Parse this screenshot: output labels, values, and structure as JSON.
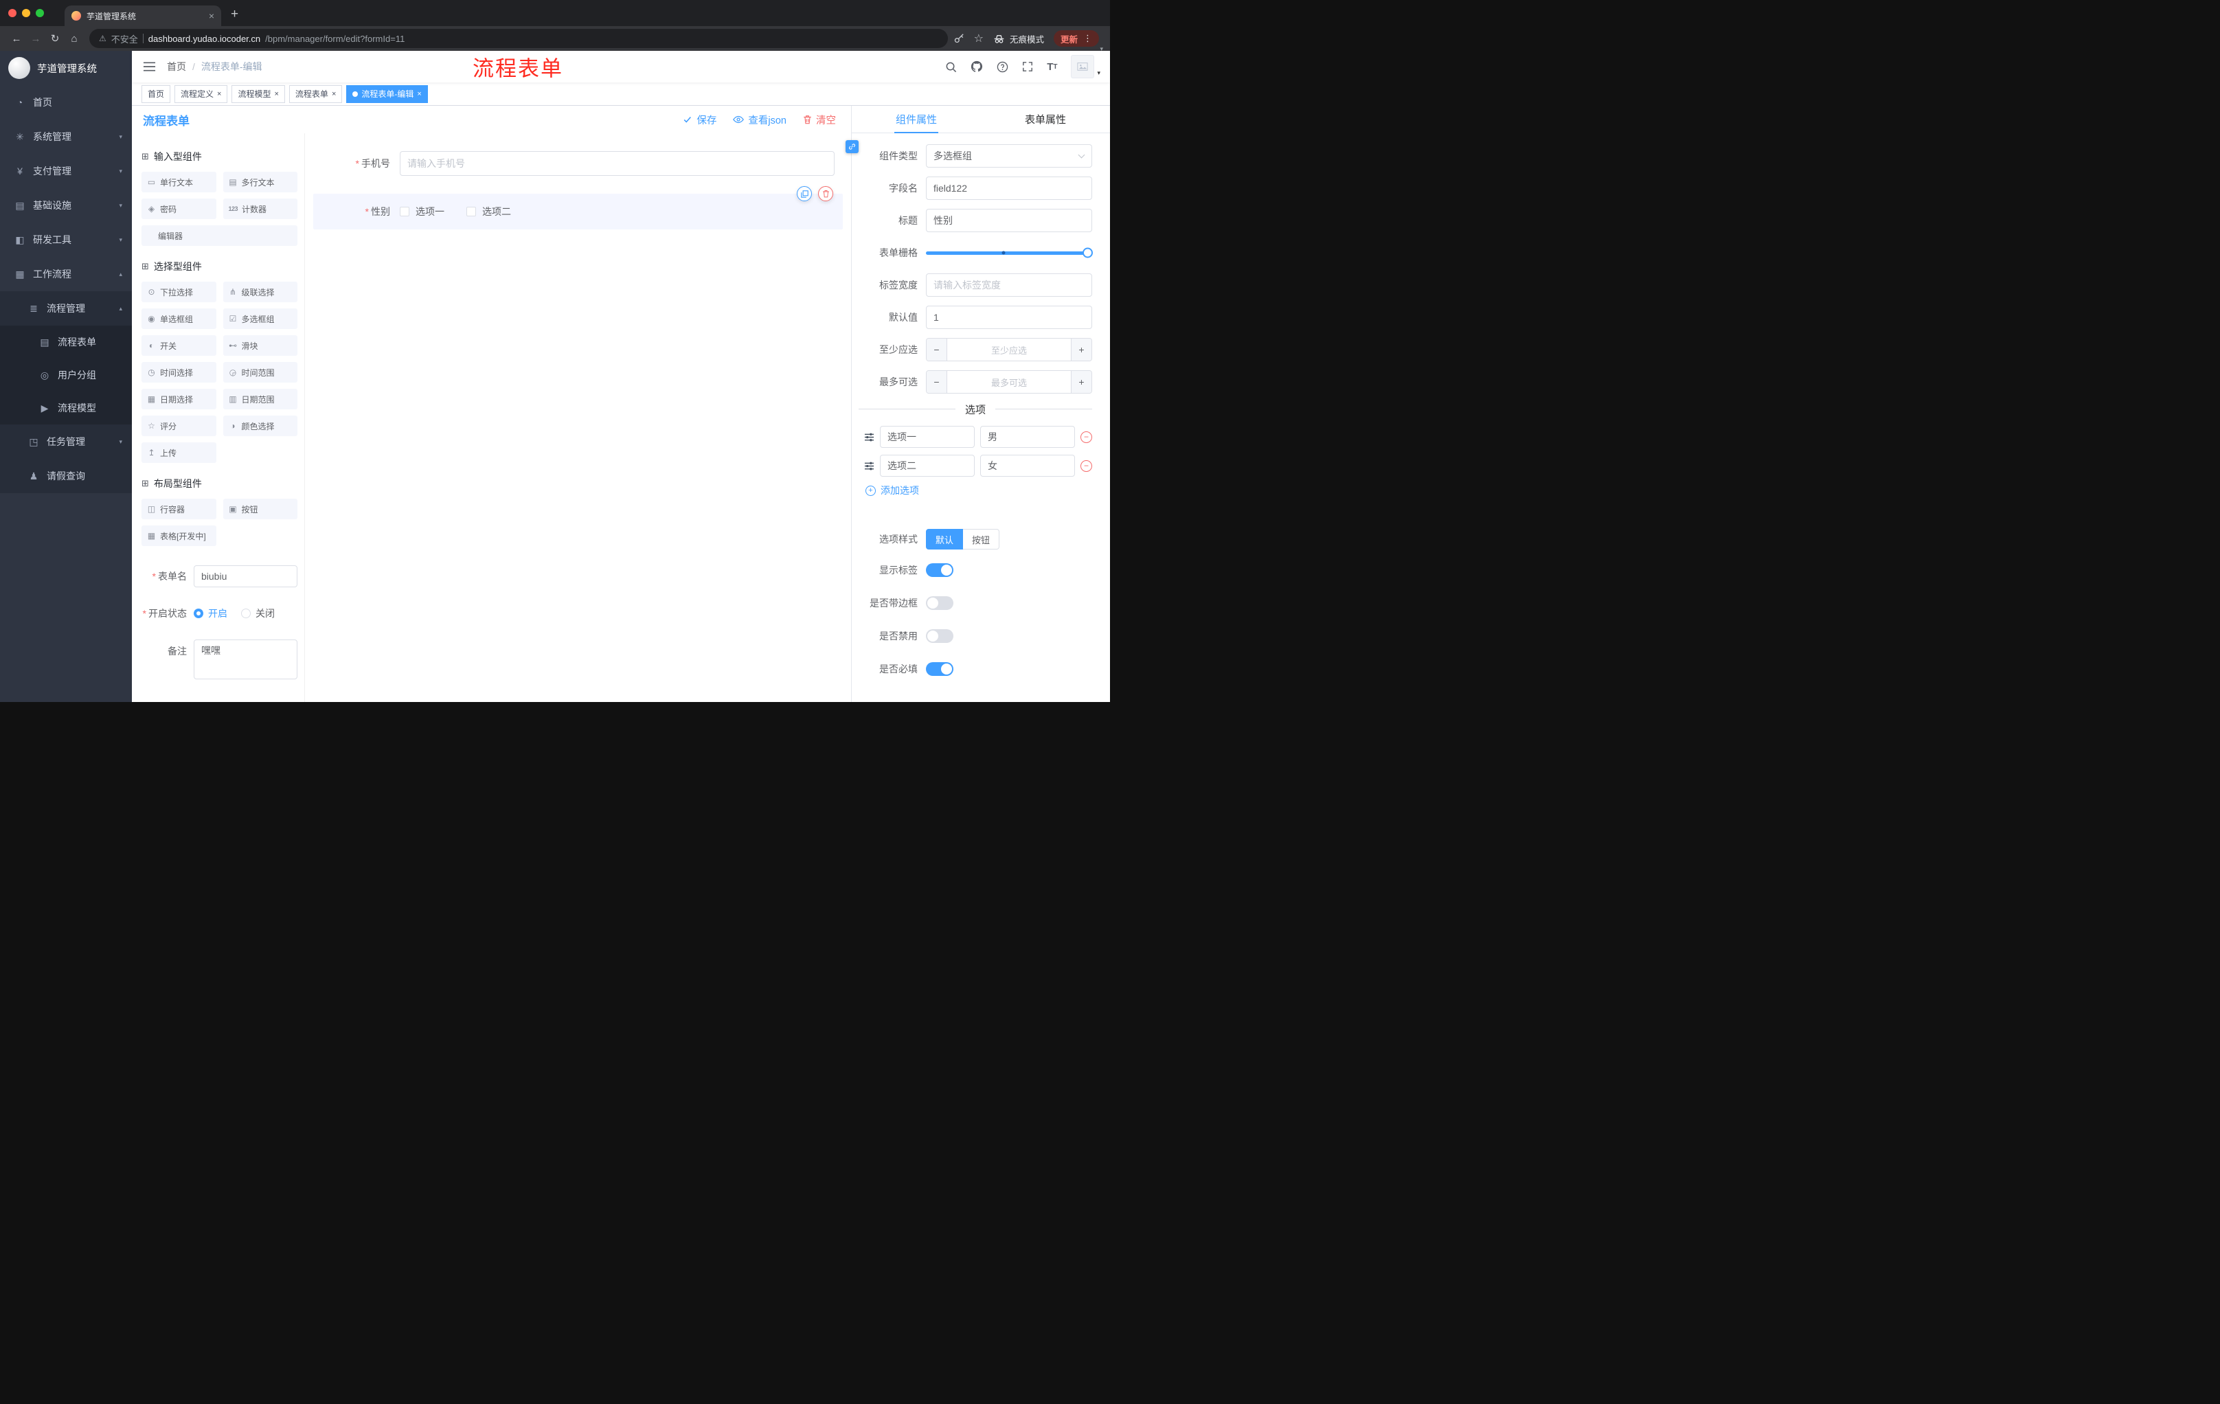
{
  "browser": {
    "tab_title": "芋道管理系统",
    "security_label": "不安全",
    "url_domain": "dashboard.yudao.iocoder.cn",
    "url_path": "/bpm/manager/form/edit?formId=11",
    "incognito_label": "无痕模式",
    "update_label": "更新"
  },
  "icons": {
    "close": "×",
    "plus": "+",
    "dots": "⋮",
    "warning": "⚠",
    "star": "☆",
    "back": "←",
    "forward": "→",
    "reload": "↻",
    "home": "⌂",
    "caret_down": "▾",
    "asterisk": "*",
    "minus": "−",
    "plus_small": "+",
    "group": "⊞"
  },
  "sidebar": {
    "logo_title": "芋道管理系统",
    "items": [
      {
        "label": "首页",
        "icon": "◔"
      },
      {
        "label": "系统管理",
        "icon": "✳",
        "chevron": "▾"
      },
      {
        "label": "支付管理",
        "icon": "¥",
        "chevron": "▾"
      },
      {
        "label": "基础设施",
        "icon": "▤",
        "chevron": "▾"
      },
      {
        "label": "研发工具",
        "icon": "◧",
        "chevron": "▾"
      },
      {
        "label": "工作流程",
        "icon": "▦",
        "chevron": "▴"
      },
      {
        "label": "流程管理",
        "icon": "≣",
        "chevron": "▴"
      },
      {
        "label": "流程表单",
        "icon": "▤"
      },
      {
        "label": "用户分组",
        "icon": "◎"
      },
      {
        "label": "流程模型",
        "icon": "▶"
      },
      {
        "label": "任务管理",
        "icon": "◳",
        "chevron": "▾"
      },
      {
        "label": "请假查询",
        "icon": "♟"
      }
    ]
  },
  "header": {
    "breadcrumb_home": "首页",
    "breadcrumb_sep": "/",
    "breadcrumb_current": "流程表单-编辑",
    "annotation": "流程表单"
  },
  "tags": [
    {
      "label": "首页"
    },
    {
      "label": "流程定义"
    },
    {
      "label": "流程模型"
    },
    {
      "label": "流程表单"
    },
    {
      "label": "流程表单-编辑"
    }
  ],
  "designer": {
    "title": "流程表单",
    "save_label": "保存",
    "view_json_label": "查看json",
    "clear_label": "清空",
    "palette_groups": [
      {
        "title": "输入型组件",
        "items": [
          {
            "label": "单行文本",
            "icon": "▭"
          },
          {
            "label": "多行文本",
            "icon": "▤"
          },
          {
            "label": "密码",
            "icon": "◈"
          },
          {
            "label": "计数器",
            "icon": "123"
          },
          {
            "label": "编辑器",
            "icon": ""
          }
        ]
      },
      {
        "title": "选择型组件",
        "items": [
          {
            "label": "下拉选择",
            "icon": "⊙"
          },
          {
            "label": "级联选择",
            "icon": "⋔"
          },
          {
            "label": "单选框组",
            "icon": "◉"
          },
          {
            "label": "多选框组",
            "icon": "☑"
          },
          {
            "label": "开关",
            "icon": "◐"
          },
          {
            "label": "滑块",
            "icon": "⊷"
          },
          {
            "label": "时间选择",
            "icon": "◷"
          },
          {
            "label": "时间范围",
            "icon": "◶"
          },
          {
            "label": "日期选择",
            "icon": "▦"
          },
          {
            "label": "日期范围",
            "icon": "▥"
          },
          {
            "label": "评分",
            "icon": "☆"
          },
          {
            "label": "颜色选择",
            "icon": "◑"
          },
          {
            "label": "上传",
            "icon": "↥"
          }
        ]
      },
      {
        "title": "布局型组件",
        "items": [
          {
            "label": "行容器",
            "icon": "◫"
          },
          {
            "label": "按钮",
            "icon": "▣"
          },
          {
            "label": "表格[开发中]",
            "icon": "▦"
          }
        ]
      }
    ],
    "meta": {
      "name_label": "表单名",
      "name_value": "biubiu",
      "status_label": "开启状态",
      "status_on": "开启",
      "status_off": "关闭",
      "remark_label": "备注",
      "remark_value": "嘿嘿"
    },
    "canvas": {
      "phone_label": "手机号",
      "phone_placeholder": "请输入手机号",
      "gender_label": "性别",
      "gender_opt1": "选项一",
      "gender_opt2": "选项二"
    }
  },
  "props": {
    "tab_component": "组件属性",
    "tab_form": "表单属性",
    "rows": {
      "type_label": "组件类型",
      "type_value": "多选框组",
      "field_label": "字段名",
      "field_value": "field122",
      "title_label": "标题",
      "title_value": "性别",
      "grid_label": "表单栅格",
      "labelwidth_label": "标签宽度",
      "labelwidth_placeholder": "请输入标签宽度",
      "default_label": "默认值",
      "default_value": "1",
      "min_label": "至少应选",
      "min_placeholder": "至少应选",
      "max_label": "最多可选",
      "max_placeholder": "最多可选"
    },
    "options": {
      "divider": "选项",
      "rows": [
        {
          "name": "选项一",
          "value": "男"
        },
        {
          "name": "选项二",
          "value": "女"
        }
      ],
      "add_label": "添加选项"
    },
    "style": {
      "label": "选项样式",
      "seg_default": "默认",
      "seg_button": "按钮",
      "toggles": [
        {
          "label": "显示标签",
          "on": true
        },
        {
          "label": "是否带边框",
          "on": false
        },
        {
          "label": "是否禁用",
          "on": false
        },
        {
          "label": "是否必填",
          "on": true
        }
      ]
    }
  },
  "colors": {
    "primary": "#409eff",
    "danger": "#f56c6c",
    "annotation_red": "#fe2b20",
    "sidebar_bg": "#2f3542"
  }
}
